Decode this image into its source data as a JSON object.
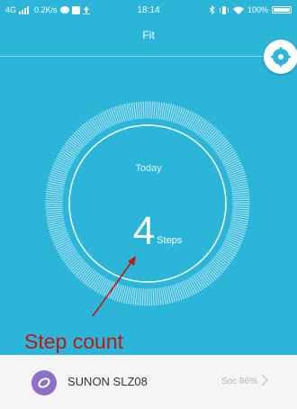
{
  "status_bar": {
    "network": "4G",
    "speed": "0.2K/s",
    "time": "18:14",
    "battery": "100%",
    "battery_level": 1.0
  },
  "header": {
    "title": "Fit"
  },
  "activity": {
    "period": "Today",
    "step_count": "4",
    "unit": "Steps"
  },
  "annotation": {
    "label": "Step count"
  },
  "device": {
    "name": "SUNON SLZ08",
    "battery": "Soc 86%"
  },
  "colors": {
    "accent": "#2bb5d8",
    "annotation": "#c4160f",
    "device_icon": "#8e6fc7"
  },
  "icons": {
    "settings": "gear-icon",
    "device": "watch-icon",
    "chevron": "chevron-right-icon"
  }
}
